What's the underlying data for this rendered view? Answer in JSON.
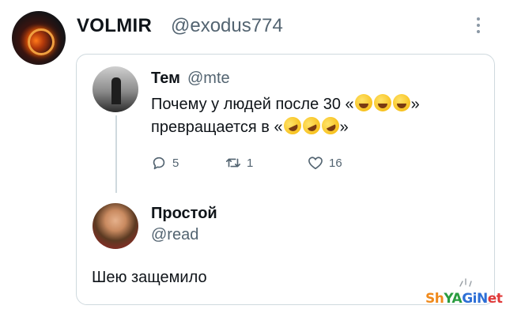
{
  "post": {
    "author_name": "VOLMIR",
    "author_handle": "@exodus774"
  },
  "quoted": {
    "name": "Тем",
    "handle": "@mte",
    "text_line1": "Почему у людей после 30 «",
    "text_line1_end": "»",
    "text_line2": "превращается в «",
    "text_line2_end": "»",
    "emoji_line1": "joy-emoji",
    "emoji_line2": "rofl-emoji",
    "replies": "5",
    "retweets": "1",
    "likes": "16"
  },
  "reply": {
    "name": "Простой",
    "handle": "@read",
    "text": "Шею защемило"
  },
  "watermark": {
    "part1": "Sh",
    "part2": "YA",
    "part3": "GiN",
    "part4": "et"
  }
}
